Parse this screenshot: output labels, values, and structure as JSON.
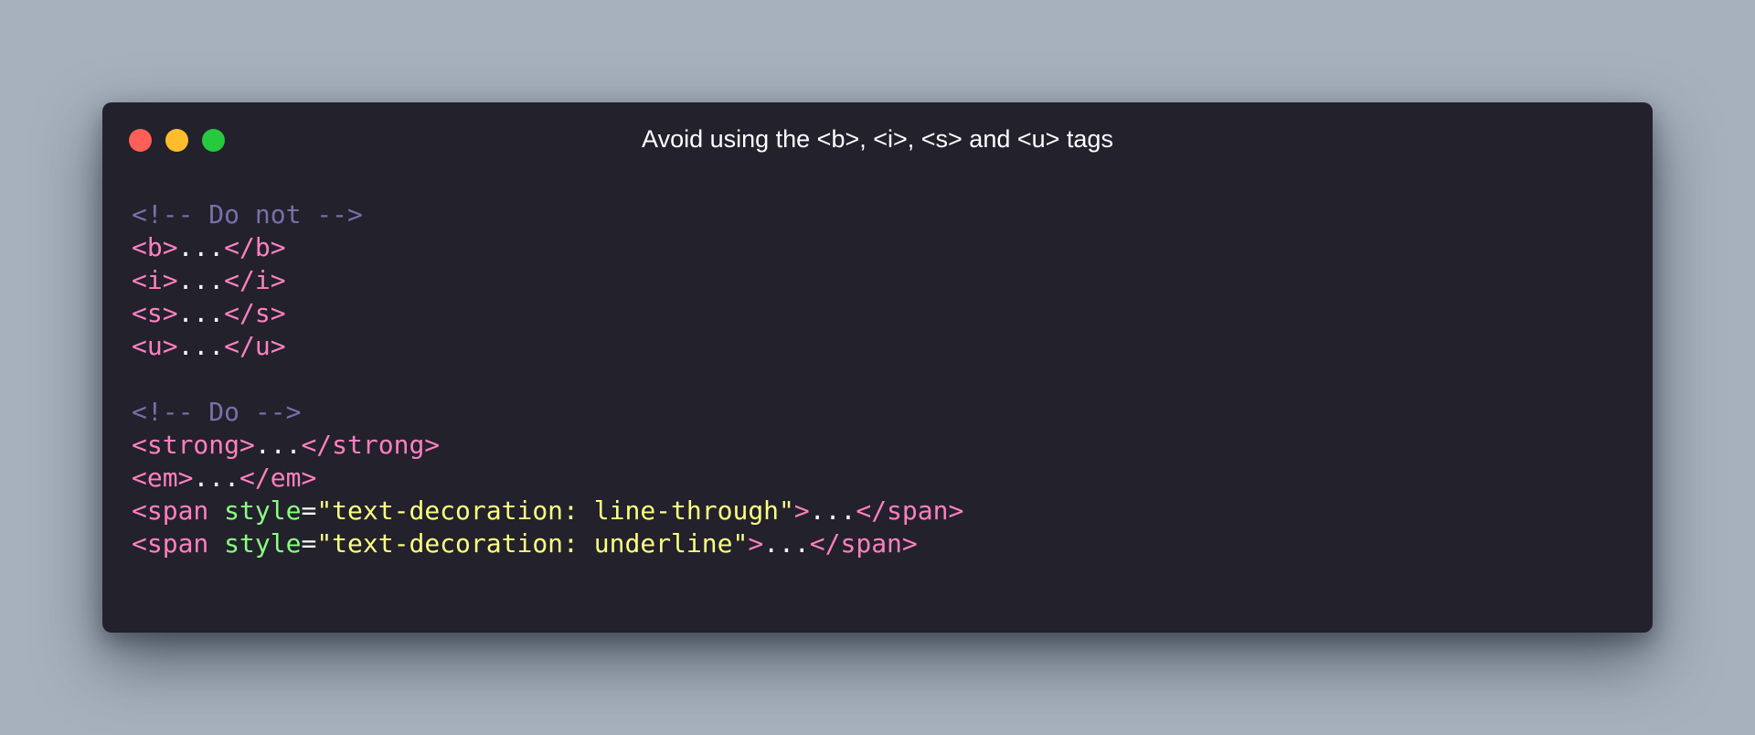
{
  "window": {
    "title": "Avoid using the <b>, <i>, <s> and <u> tags",
    "controls": {
      "close_color": "#ff5f56",
      "minimize_color": "#ffbd2e",
      "maximize_color": "#27c93f"
    }
  },
  "colors": {
    "background": "#a6b1bd",
    "editor_background": "#22212c",
    "comment": "#7970a9",
    "tag": "#ff80bf",
    "attribute": "#8aff80",
    "string": "#ffff80",
    "plain": "#f8f8f2"
  },
  "code_lines": [
    [
      {
        "type": "comment",
        "text": "<!-- Do not -->"
      }
    ],
    [
      {
        "type": "tag",
        "text": "<b>"
      },
      {
        "type": "plain",
        "text": "..."
      },
      {
        "type": "tag",
        "text": "</b>"
      }
    ],
    [
      {
        "type": "tag",
        "text": "<i>"
      },
      {
        "type": "plain",
        "text": "..."
      },
      {
        "type": "tag",
        "text": "</i>"
      }
    ],
    [
      {
        "type": "tag",
        "text": "<s>"
      },
      {
        "type": "plain",
        "text": "..."
      },
      {
        "type": "tag",
        "text": "</s>"
      }
    ],
    [
      {
        "type": "tag",
        "text": "<u>"
      },
      {
        "type": "plain",
        "text": "..."
      },
      {
        "type": "tag",
        "text": "</u>"
      }
    ],
    [],
    [
      {
        "type": "comment",
        "text": "<!-- Do -->"
      }
    ],
    [
      {
        "type": "tag",
        "text": "<strong>"
      },
      {
        "type": "plain",
        "text": "..."
      },
      {
        "type": "tag",
        "text": "</strong>"
      }
    ],
    [
      {
        "type": "tag",
        "text": "<em>"
      },
      {
        "type": "plain",
        "text": "..."
      },
      {
        "type": "tag",
        "text": "</em>"
      }
    ],
    [
      {
        "type": "tag",
        "text": "<span "
      },
      {
        "type": "attr",
        "text": "style"
      },
      {
        "type": "plain",
        "text": "="
      },
      {
        "type": "string",
        "text": "\"text-decoration: line-through\""
      },
      {
        "type": "tag",
        "text": ">"
      },
      {
        "type": "plain",
        "text": "..."
      },
      {
        "type": "tag",
        "text": "</span>"
      }
    ],
    [
      {
        "type": "tag",
        "text": "<span "
      },
      {
        "type": "attr",
        "text": "style"
      },
      {
        "type": "plain",
        "text": "="
      },
      {
        "type": "string",
        "text": "\"text-decoration: underline\""
      },
      {
        "type": "tag",
        "text": ">"
      },
      {
        "type": "plain",
        "text": "..."
      },
      {
        "type": "tag",
        "text": "</span>"
      }
    ]
  ]
}
